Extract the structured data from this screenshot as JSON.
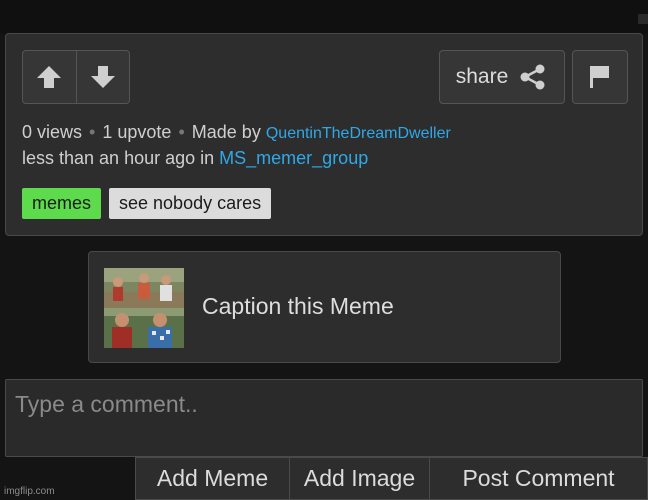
{
  "post": {
    "share_label": "share",
    "views": "0 views",
    "upvotes": "1 upvote",
    "made_by_prefix": "Made by",
    "author": "QuentinTheDreamDweller",
    "time_prefix": "less than an hour ago in",
    "stream": "MS_memer_group",
    "tags": [
      "memes",
      "see nobody cares"
    ],
    "icons": {
      "upvote": "arrow-up-icon",
      "downvote": "arrow-down-icon",
      "share": "share-icon",
      "flag": "flag-icon"
    }
  },
  "caption_card": {
    "label": "Caption this Meme"
  },
  "comment": {
    "placeholder": "Type a comment.."
  },
  "actions": {
    "add_meme": "Add Meme",
    "add_image": "Add Image",
    "post_comment": "Post Comment"
  },
  "watermark": "imgflip.com",
  "colors": {
    "link": "#2fa8e8",
    "tag_green": "#5ddb4c",
    "tag_light": "#dcdcdc",
    "card_bg": "#2d2d2d",
    "page_bg": "#141414"
  }
}
